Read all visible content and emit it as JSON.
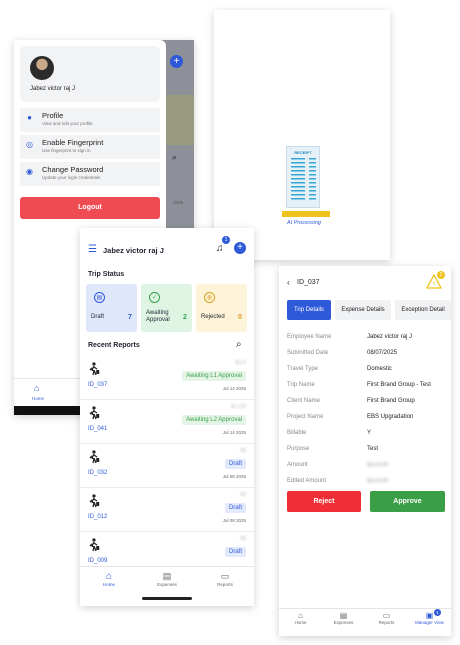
{
  "drawer": {
    "user_name": "Jabez victor raj J",
    "menu": [
      {
        "title": "Profile",
        "subtitle": "View and edit your profile",
        "icon": "user-icon"
      },
      {
        "title": "Enable Fingerprint",
        "subtitle": "Use fingerprint to sign in",
        "icon": "fingerprint-icon"
      },
      {
        "title": "Change Password",
        "subtitle": "Update your login credentials",
        "icon": "key-icon"
      }
    ],
    "logout_label": "Logout",
    "behind_nav_label": "Home",
    "behind_amounts": [
      "2025"
    ]
  },
  "processing": {
    "receipt_label": "RECEIPT",
    "caption": "AI Processing"
  },
  "home": {
    "user_name": "Jabez victor raj J",
    "notification_count": "1",
    "trip_status_title": "Trip Status",
    "status_cards": [
      {
        "label": "Draft",
        "count": "7",
        "color": "#dfe8fb",
        "icon_color": "#2e59d9"
      },
      {
        "label": "Awaiting Approval",
        "count": "2",
        "color": "#dff5e3",
        "icon_color": "#3aa04e"
      },
      {
        "label": "Rejected",
        "count": "0",
        "color": "#fdf3d8",
        "icon_color": "#d9a021"
      }
    ],
    "recent_reports_title": "Recent Reports",
    "reports": [
      {
        "id": "ID_037",
        "status": "Awaiting L1 Approval",
        "date": "Jul 14 2025",
        "amount": "$113",
        "type": "approval"
      },
      {
        "id": "ID_041",
        "status": "Awaiting L2 Approval",
        "date": "Jul 14 2025",
        "amount": "$1,129",
        "type": "approval"
      },
      {
        "id": "ID_032",
        "status": "Draft",
        "date": "Jul 08 2025",
        "amount": "$0",
        "type": "draft"
      },
      {
        "id": "ID_012",
        "status": "Draft",
        "date": "Jul 08 2025",
        "amount": "$0",
        "type": "draft"
      },
      {
        "id": "ID_009",
        "status": "Draft",
        "date": "",
        "amount": "$0",
        "type": "draft"
      }
    ],
    "nav": [
      "Home",
      "Expenses",
      "Reports"
    ]
  },
  "detail": {
    "title": "ID_037",
    "warning_count": "2",
    "tabs": [
      "Trip Details",
      "Expense Details",
      "Exception Detail"
    ],
    "fields": [
      {
        "label": "Employee Name",
        "value": "Jabez victor raj J",
        "blur": false
      },
      {
        "label": "Submitted Date",
        "value": "08/07/2025",
        "blur": false
      },
      {
        "label": "Travel Type",
        "value": "Domestic",
        "blur": false
      },
      {
        "label": "Trip Name",
        "value": "First Brand Group - Test",
        "blur": false
      },
      {
        "label": "Client Name",
        "value": "First Brand Group",
        "blur": false
      },
      {
        "label": "Project Name",
        "value": "EBS Upgradation",
        "blur": false
      },
      {
        "label": "Billable",
        "value": "Y",
        "blur": false
      },
      {
        "label": "Purpose",
        "value": "Test",
        "blur": false
      },
      {
        "label": "Amount",
        "value": "$113.00",
        "blur": true
      },
      {
        "label": "Edited Amount",
        "value": "$113.00",
        "blur": true
      }
    ],
    "reject_label": "Reject",
    "approve_label": "Approve",
    "nav": [
      "Home",
      "Expenses",
      "Reports",
      "Manager View"
    ],
    "manager_badge": "1"
  },
  "colors": {
    "primary": "#2e59d9",
    "danger": "#ef4b53",
    "success": "#3a9e47",
    "approval_badge_bg": "#e4f5e6",
    "approval_badge_text": "#3aa04e",
    "draft_badge_bg": "#e2e9fb",
    "warning": "#f0c21c"
  }
}
